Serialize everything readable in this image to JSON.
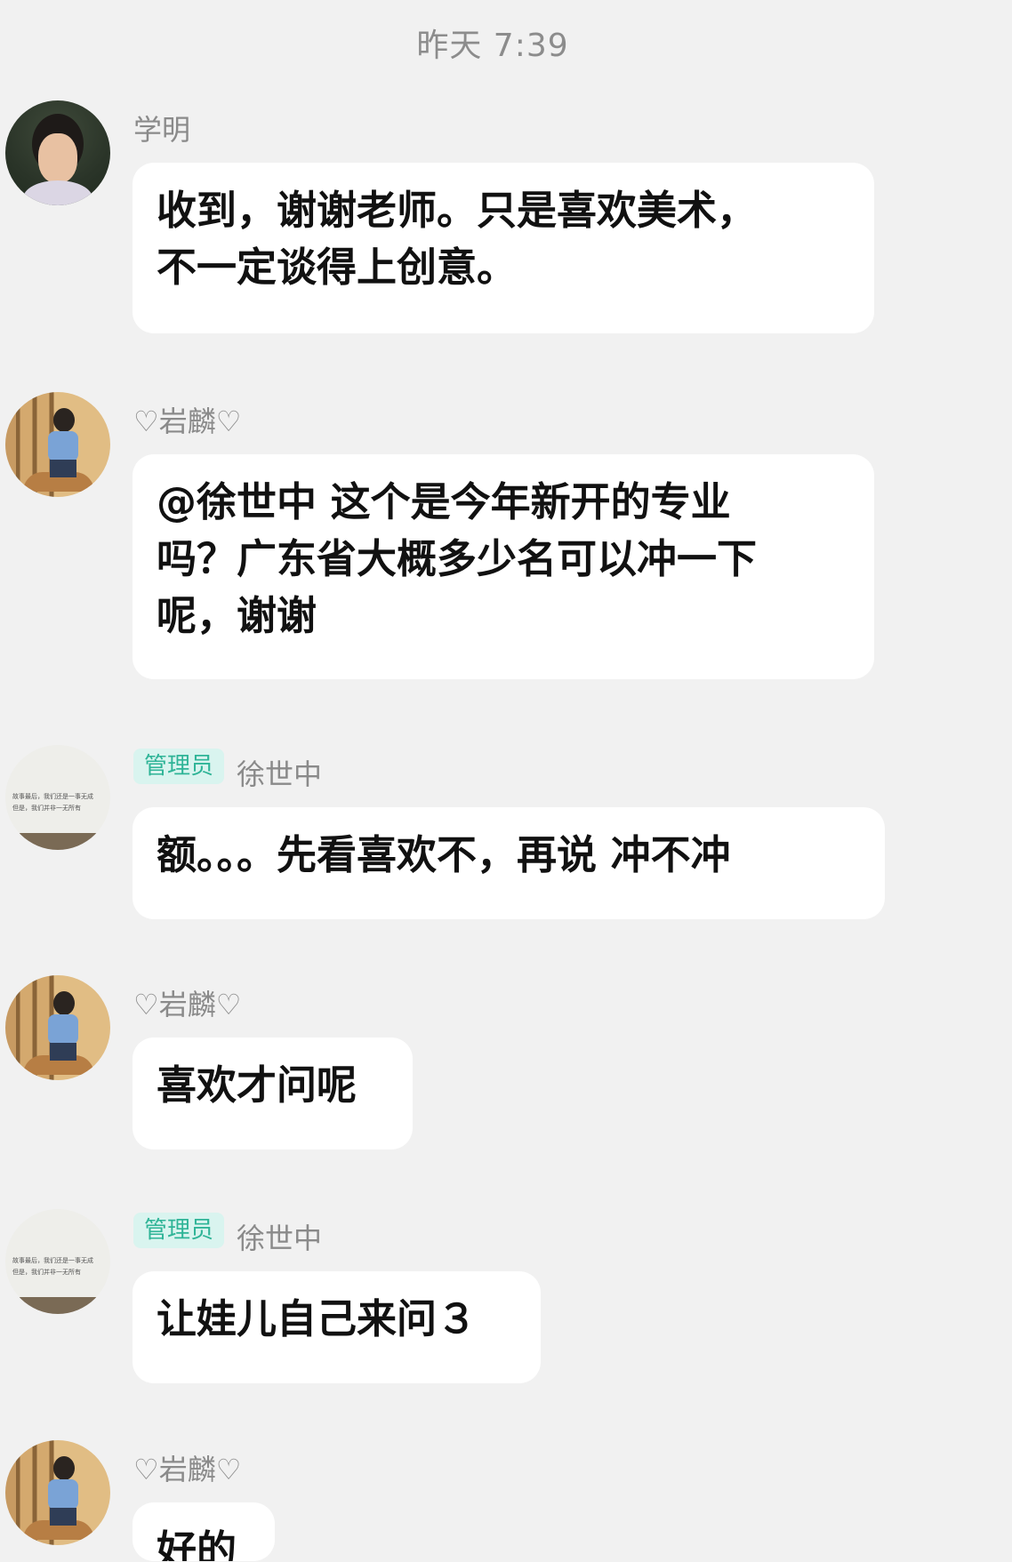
{
  "chat": {
    "timestamp": "昨天 7:39",
    "messages": [
      {
        "sender": "学明",
        "badge": "",
        "text": "收到，谢谢老师。只是喜欢美术，\n不一定谈得上创意。"
      },
      {
        "sender": "♡岩麟♡",
        "badge": "",
        "text": "@徐世中 这个是今年新开的专业\n吗？广东省大概多少名可以冲一下\n呢，谢谢"
      },
      {
        "sender": "徐世中",
        "badge": "管理员",
        "text": "额。。。先看喜欢不，再说 冲不冲"
      },
      {
        "sender": "♡岩麟♡",
        "badge": "",
        "text": "喜欢才问呢"
      },
      {
        "sender": "徐世中",
        "badge": "管理员",
        "text": "让娃儿自己来问３"
      },
      {
        "sender": "♡岩麟♡",
        "badge": "",
        "text": "好的"
      }
    ],
    "avatar_text": "故事最后，我们还是一事无成\n但是，我们并非一无所有"
  }
}
